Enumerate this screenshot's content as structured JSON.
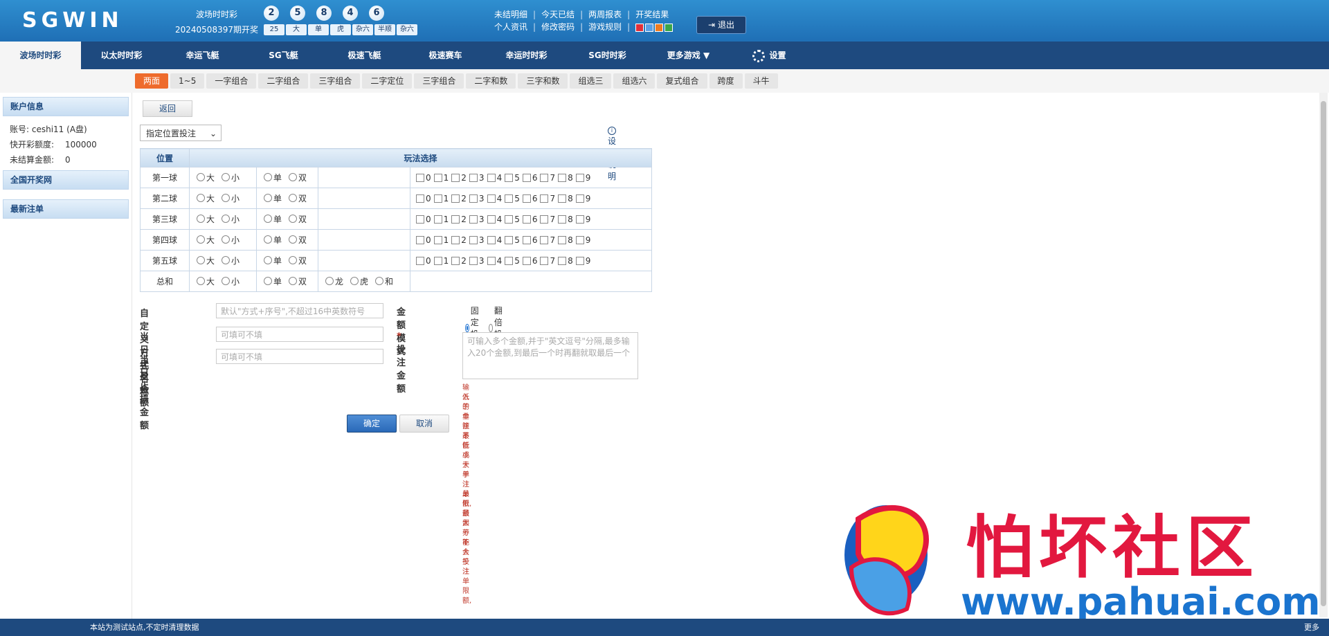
{
  "header": {
    "logo": "SGWIN",
    "lottery_name": "波场时时彩",
    "draw_period": "20240508397期开奖",
    "balls": [
      "2",
      "5",
      "8",
      "4",
      "6"
    ],
    "stats": [
      "25",
      "大",
      "单",
      "虎",
      "杂六",
      "半顺",
      "杂六"
    ],
    "links_row1": [
      "未结明细",
      "今天已结",
      "两周报表",
      "开奖结果"
    ],
    "links_row2": [
      "个人资讯",
      "修改密码",
      "游戏规则"
    ],
    "swatch_colors": [
      "#e0303a",
      "#5aa0e6",
      "#ee7b20",
      "#3aa64a"
    ],
    "logout": "退出"
  },
  "nav": {
    "items": [
      "波场时时彩",
      "以太时时彩",
      "幸运飞艇",
      "SG飞艇",
      "极速飞艇",
      "极速赛车",
      "幸运时时彩",
      "SG时时彩",
      "更多游戏 ▼",
      "设置"
    ]
  },
  "subnav": {
    "tabs": [
      "两面",
      "1~5",
      "一字组合",
      "二字组合",
      "三字组合",
      "二字定位",
      "三字组合",
      "二字和数",
      "三字和数",
      "组选三",
      "组选六",
      "复式组合",
      "跨度",
      "斗牛"
    ]
  },
  "sidebar": {
    "account_title": "账户信息",
    "account_label": "账号:",
    "account_value": "ceshi11 (A盘)",
    "quota_label": "快开彩额度:",
    "quota_value": "100000",
    "unsettled_label": "未结算金额:",
    "unsettled_value": "0",
    "draw_title": "全国开奖网",
    "latest_title": "最新注单"
  },
  "main": {
    "back": "返回",
    "select_value": "指定位置投注",
    "help": "设置说明",
    "col_pos": "位置",
    "col_play": "玩法选择",
    "rows": [
      "第一球",
      "第二球",
      "第三球",
      "第四球",
      "第五球"
    ],
    "sum_row": "总和",
    "big": "大",
    "small": "小",
    "odd": "单",
    "even": "双",
    "dragon": "龙",
    "tiger": "虎",
    "tie": "和",
    "digits": [
      "0",
      "1",
      "2",
      "3",
      "4",
      "5",
      "6",
      "7",
      "8",
      "9"
    ],
    "form": {
      "name_label": "自定义方式名称",
      "name_placeholder": "默认\"方式+序号\",不超过16中英数符号",
      "stop_win_label": "当日止盈金额",
      "stop_win_placeholder": "可填可不填",
      "stop_loss_label": "当日止损金额",
      "stop_loss_placeholder": "可填可不填",
      "amount_mode_label": "金额模式",
      "mode_fixed": "固定投注",
      "mode_double": "翻倍投注",
      "bet_amount_label": "投注金额",
      "required_mark": "*",
      "bet_placeholder": "可输入多个金额,并于\"英文逗号\"分隔,最多输入20个金额,到最后一个时再翻就取最后一个",
      "warn1": "输入的金额不能小于单注最低, 最大不能大于注单限额,",
      "warn2": "低于单注最低或大于注单限额部分不会投注",
      "ok": "确定",
      "cancel": "取消"
    }
  },
  "footer": {
    "notice": "本站为测试站点,不定时清理数据",
    "more": "更多"
  },
  "watermark": {
    "text": "怕坏社区",
    "url": "www.pahuai.com"
  }
}
